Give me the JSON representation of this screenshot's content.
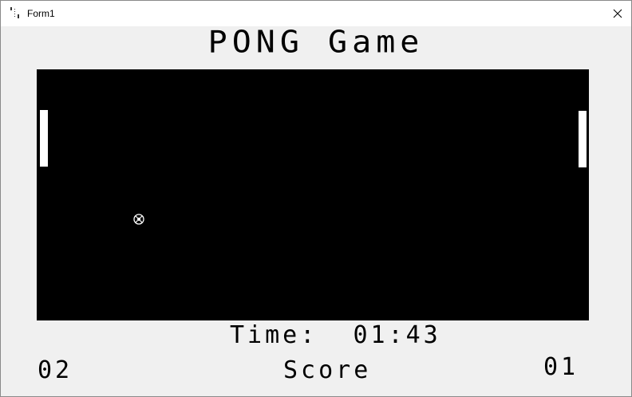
{
  "window": {
    "title": "Form1",
    "icon": "form-icon",
    "close_icon": "close-icon"
  },
  "game": {
    "title": "PONG Game",
    "time_label": "Time:",
    "time_value": "01:43",
    "score_label": "Score",
    "left_score": "02",
    "right_score": "01"
  },
  "colors": {
    "court": "#000000",
    "paddle": "#ffffff",
    "ball": "#ffffff",
    "background": "#f0f0f0"
  }
}
